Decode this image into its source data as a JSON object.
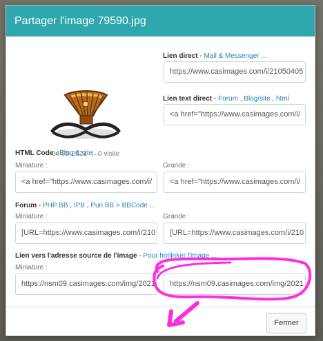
{
  "dialog": {
    "title": "Partager l'image 79590.jpg"
  },
  "image": {
    "date": "04-05-2021",
    "visits": "0 visite",
    "separator": "|"
  },
  "direct_link": {
    "label": "Lien direct",
    "dash": " - ",
    "link": "Mail & Messenger ...",
    "value": "https://www.casimages.com/i/21050405"
  },
  "text_direct_link": {
    "label": "Lien text direct",
    "dash": " - ",
    "links": [
      "Forum",
      "Blog/site",
      "html"
    ],
    "comma": " , ",
    "value": "<a href=\"https://www.casimages.com/i/"
  },
  "html_code": {
    "label": "HTML Code",
    "dash": " - ",
    "link": "Blog & site ...",
    "miniature_label": "Miniature :",
    "grande_label": "Grande :",
    "miniature_value": "<a href=\"https://www.casimages.com/i/",
    "grande_value": "<a href=\"https://www.casimages.com/i/"
  },
  "forum": {
    "label": "Forum",
    "dash": " - ",
    "links": [
      "PHP BB",
      "IPB",
      "Pun BB > BBCode ..."
    ],
    "comma": " , ",
    "miniature_label": "Miniature :",
    "grande_label": "Grande :",
    "miniature_value": "[URL=https://www.casimages.com/i/210",
    "grande_value": "[URL=https://www.casimages.com/i/210"
  },
  "source_link": {
    "label": "Lien vers l'adresse source de l'image",
    "dash": " - ",
    "link": "Pour hotlinker l'image ...",
    "miniature_label": "Miniature :",
    "miniature_value": "https://nsm09.casimages.com/img/2021",
    "grande_value": "https://nsm09.casimages.com/img/2021"
  },
  "footer": {
    "close_label": "Fermer"
  },
  "colors": {
    "header": "#2ea8ac",
    "link": "#2b80c2",
    "annotation": "#ff2de2"
  },
  "icons": {
    "thumbnail": "fan-image-icon",
    "annotation": "circle-arrow-icon"
  }
}
